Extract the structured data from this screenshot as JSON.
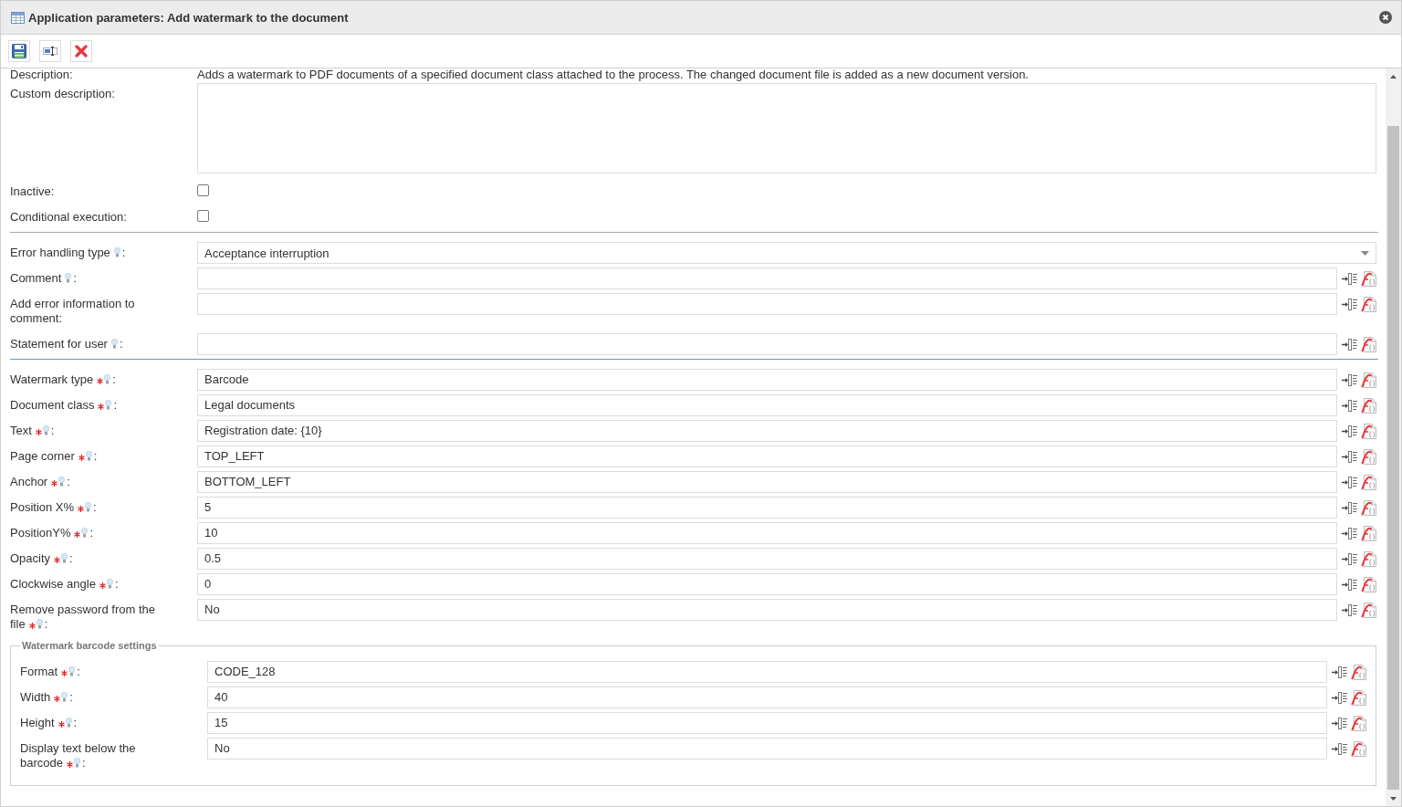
{
  "window": {
    "title": "Application parameters: Add watermark to the document"
  },
  "toolbar": [
    {
      "kind": "save"
    },
    {
      "kind": "field"
    },
    {
      "kind": "cancel"
    }
  ],
  "sections": [
    {
      "fields": [
        {
          "kind": "static",
          "label": "Description:",
          "value": "Adds a watermark to PDF documents of a specified document class attached to the process. The changed document file is added as a new document version."
        },
        {
          "kind": "textarea",
          "label": "Custom description:"
        },
        {
          "kind": "checkbox",
          "label": "Inactive:",
          "checked": false
        },
        {
          "kind": "checkbox",
          "label": "Conditional execution:",
          "checked": false
        }
      ]
    },
    {
      "fields": [
        {
          "kind": "select",
          "label": "Error handling type",
          "required": false,
          "help": true,
          "colon": ":",
          "value": "Acceptance interruption"
        },
        {
          "kind": "text",
          "label": "Comment",
          "required": false,
          "help": true,
          "colon": ":"
        },
        {
          "kind": "text",
          "label": "Add error information to comment:",
          "required": false,
          "help": false
        },
        {
          "kind": "text",
          "label": "Statement for user",
          "required": false,
          "help": true,
          "colon": ":"
        }
      ]
    },
    {
      "fields": [
        {
          "kind": "text",
          "label": "Watermark type",
          "required": true,
          "help": true,
          "colon": ":",
          "value": "Barcode"
        },
        {
          "kind": "text",
          "label": "Document class",
          "required": true,
          "help": true,
          "colon": ":",
          "value": "Legal documents"
        },
        {
          "kind": "text",
          "label": "Text",
          "required": true,
          "help": true,
          "colon": ":",
          "value": "Registration date: {10}"
        },
        {
          "kind": "text",
          "label": "Page corner",
          "required": true,
          "help": true,
          "colon": ":",
          "value": "TOP_LEFT"
        },
        {
          "kind": "text",
          "label": "Anchor",
          "required": true,
          "help": true,
          "colon": ":",
          "value": "BOTTOM_LEFT"
        },
        {
          "kind": "text",
          "label": "Position X%",
          "required": true,
          "help": true,
          "colon": ":",
          "value": "5"
        },
        {
          "kind": "text",
          "label": "PositionY%",
          "required": true,
          "help": true,
          "colon": ":",
          "value": "10"
        },
        {
          "kind": "text",
          "label": "Opacity",
          "required": true,
          "help": true,
          "colon": ":",
          "value": "0.5"
        },
        {
          "kind": "text",
          "label": "Clockwise angle",
          "required": true,
          "help": true,
          "colon": ":",
          "value": "0"
        },
        {
          "kind": "text",
          "label": "Remove password from the file",
          "required": true,
          "help": true,
          "colon": ":",
          "value": "No"
        }
      ]
    }
  ],
  "group": {
    "legend": "Watermark barcode settings",
    "fields": [
      {
        "kind": "text",
        "label": "Format",
        "required": true,
        "help": true,
        "colon": ":",
        "value": "CODE_128"
      },
      {
        "kind": "text",
        "label": "Width",
        "required": true,
        "help": true,
        "colon": ":",
        "value": "40"
      },
      {
        "kind": "text",
        "label": "Height",
        "required": true,
        "help": true,
        "colon": ":",
        "value": "15"
      },
      {
        "kind": "text",
        "label": "Display text below the barcode",
        "required": true,
        "help": true,
        "colon": ":",
        "value": "No"
      }
    ]
  }
}
